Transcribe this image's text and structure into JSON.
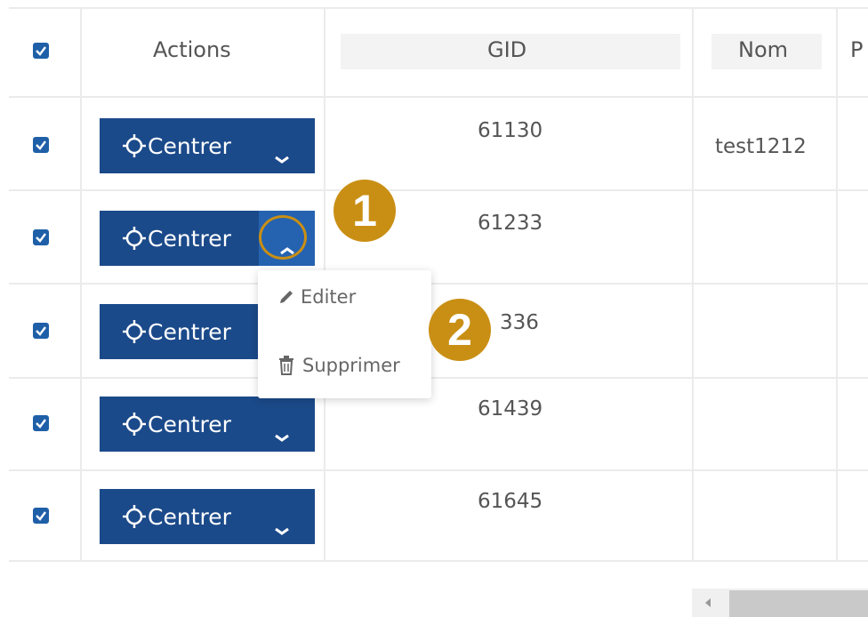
{
  "header": {
    "actions_label": "Actions",
    "gid_label": "GID",
    "nom_label": "Nom",
    "partial_label": "P"
  },
  "rows": [
    {
      "action_label": "Centrer",
      "gid": "61130",
      "nom": "test1212",
      "checked": true
    },
    {
      "action_label": "Centrer",
      "gid": "61233",
      "nom": "",
      "checked": true
    },
    {
      "action_label": "Centrer",
      "gid": "336",
      "nom": "",
      "checked": true
    },
    {
      "action_label": "Centrer",
      "gid": "61439",
      "nom": "",
      "checked": true
    },
    {
      "action_label": "Centrer",
      "gid": "61645",
      "nom": "",
      "checked": true
    }
  ],
  "dropdown": {
    "items": [
      {
        "label": "Editer",
        "icon": "pencil-icon"
      },
      {
        "label": "Supprimer",
        "icon": "trash-icon"
      }
    ]
  },
  "annotations": {
    "badge1": "1",
    "badge2": "2"
  },
  "colors": {
    "button": "#1b4a8a",
    "button_active": "#2563b0",
    "checkbox": "#1f5fa8",
    "badge": "#c98f14"
  }
}
